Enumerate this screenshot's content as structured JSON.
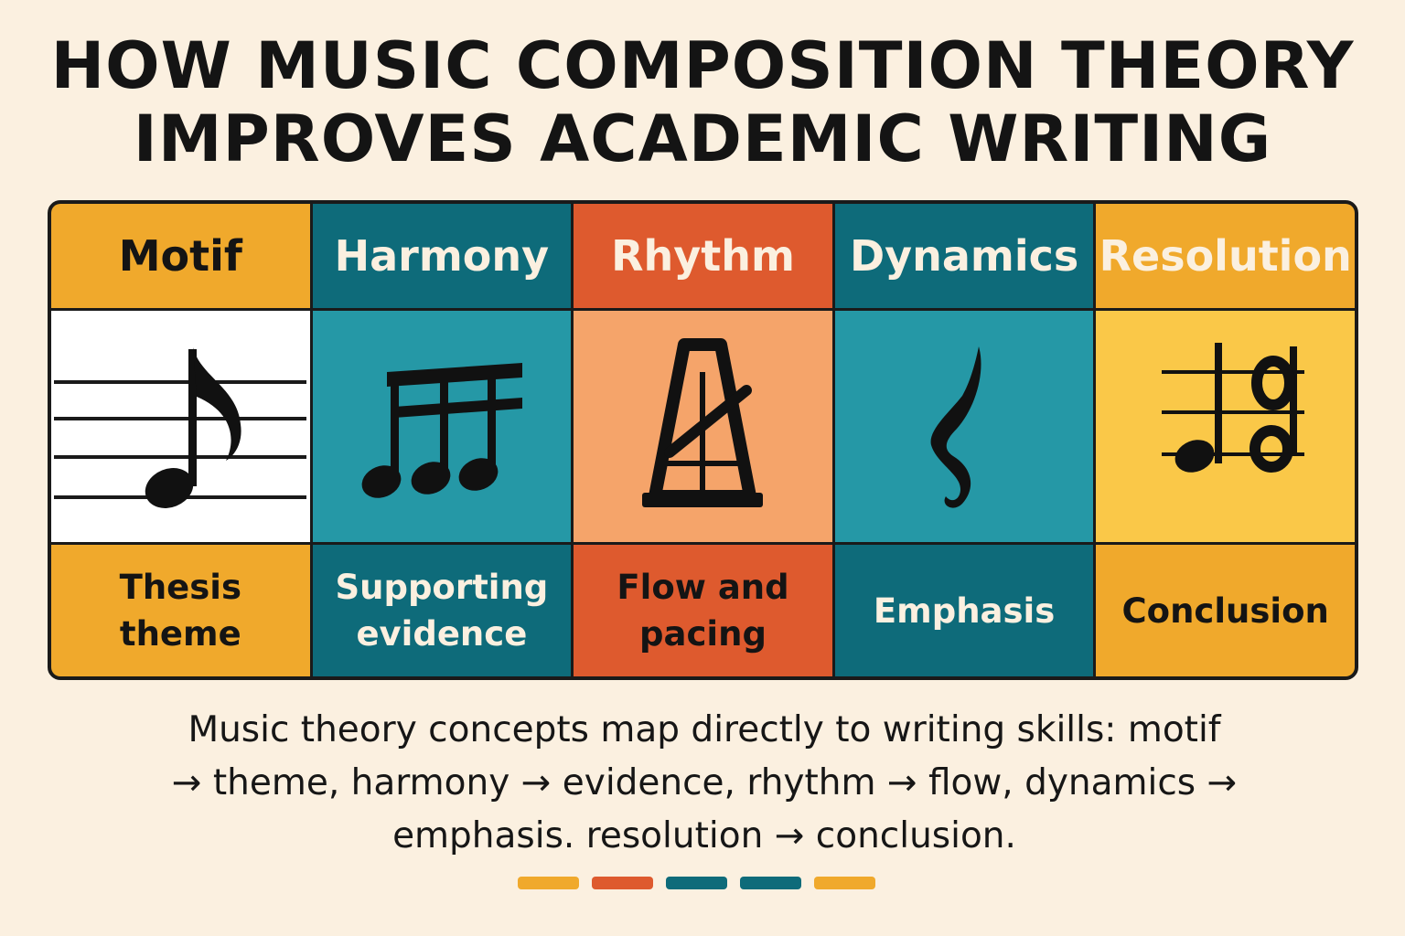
{
  "title": {
    "line1": "HOW  MUSIC COMPOSITION THEORY",
    "line2": "IMPROVES ACADEMIC WRITING"
  },
  "columns": [
    {
      "heading": "Motif",
      "icon": "eighth-note-on-staff-icon",
      "label_line1": "Thesis",
      "label_line2": "theme",
      "head_bg": "#F0A92C",
      "head_fg": "#141414",
      "icon_bg": "#FFFFFF",
      "foot_bg": "#F0A92C",
      "foot_fg": "#141414"
    },
    {
      "heading": "Harmony",
      "icon": "beamed-notes-icon",
      "label_line1": "Supporting",
      "label_line2": "evidence",
      "head_bg": "#0E6B7A",
      "head_fg": "#FBF0E0",
      "icon_bg": "#2598A6",
      "foot_bg": "#0E6B7A",
      "foot_fg": "#FBF0E0"
    },
    {
      "heading": "Rhythm",
      "icon": "metronome-icon",
      "label_line1": "Flow and",
      "label_line2": "pacing",
      "head_bg": "#DE5A2E",
      "head_fg": "#FBF0E0",
      "icon_bg": "#F5A46A",
      "foot_bg": "#DE5A2E",
      "foot_fg": "#141414"
    },
    {
      "heading": "Dynamics",
      "icon": "dynamic-mark-icon",
      "label_line1": "Emphasis",
      "label_line2": "",
      "head_bg": "#0E6B7A",
      "head_fg": "#FBF0E0",
      "icon_bg": "#2598A6",
      "foot_bg": "#0E6B7A",
      "foot_fg": "#FBF0E0"
    },
    {
      "heading": "Resolution",
      "icon": "resolving-chord-icon",
      "label_line1": "Conclusion",
      "label_line2": "",
      "head_bg": "#F0A92C",
      "head_fg": "#FBF0E0",
      "icon_bg": "#FAC848",
      "foot_bg": "#F0A92C",
      "foot_fg": "#141414"
    }
  ],
  "caption": {
    "line1": "Music theory concepts map directly to writing skills: motif",
    "line2": "→ theme, harmony → evidence, rhythm → flow, dynamics →",
    "line3": "emphasis. resolution → conclusion."
  },
  "accent_dots": [
    "#F0A92C",
    "#DE5A2E",
    "#0E6B7A",
    "#0E6B7A",
    "#F0A92C"
  ]
}
